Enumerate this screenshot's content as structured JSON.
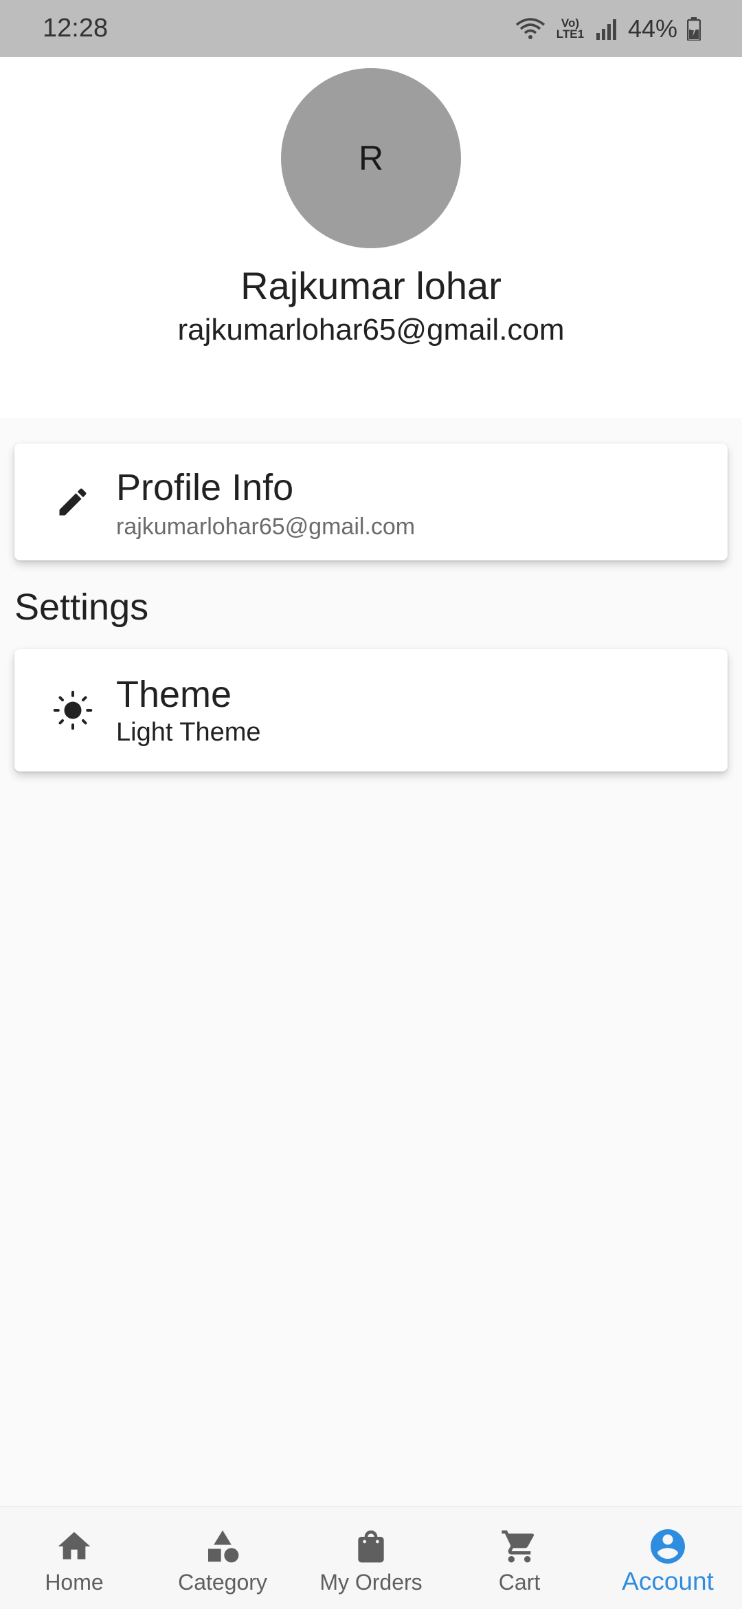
{
  "status_bar": {
    "time": "12:28",
    "network_label": "Vo) LTE1",
    "battery": "44%"
  },
  "profile": {
    "avatar_initial": "R",
    "name": "Rajkumar lohar",
    "email": "rajkumarlohar65@gmail.com"
  },
  "profile_card": {
    "icon": "edit-icon",
    "title": "Profile Info",
    "subtitle": "rajkumarlohar65@gmail.com"
  },
  "settings": {
    "section_title": "Settings",
    "theme_card": {
      "icon": "sun-icon",
      "title": "Theme",
      "subtitle": "Light Theme"
    }
  },
  "bottom_nav": {
    "active_color": "#2e8ddf",
    "inactive_color": "#5f5f5f",
    "items": [
      {
        "label": "Home",
        "icon": "home-icon",
        "active": false
      },
      {
        "label": "Category",
        "icon": "category-icon",
        "active": false
      },
      {
        "label": "My Orders",
        "icon": "shopping-bag-icon",
        "active": false
      },
      {
        "label": "Cart",
        "icon": "cart-icon",
        "active": false
      },
      {
        "label": "Account",
        "icon": "account-circle-icon",
        "active": true
      }
    ]
  }
}
